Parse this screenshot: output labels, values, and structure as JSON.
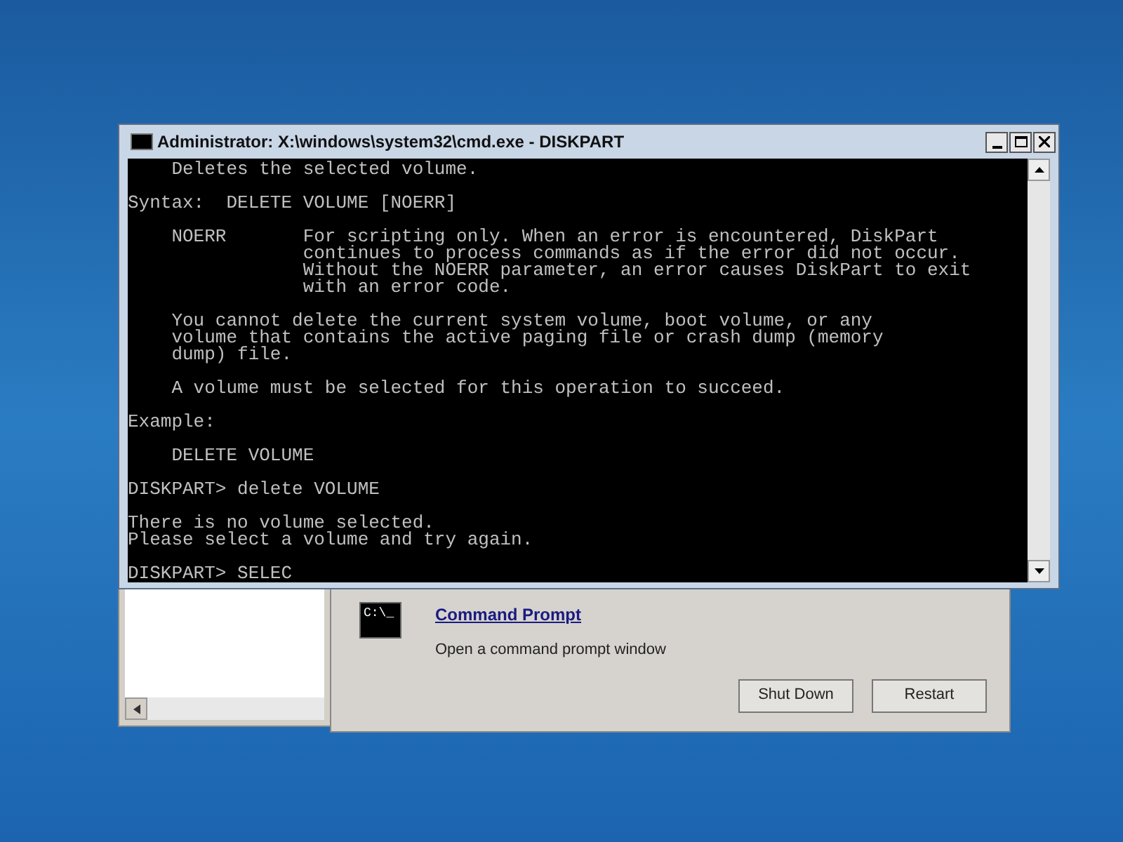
{
  "console_window": {
    "title": "Administrator: X:\\windows\\system32\\cmd.exe - DISKPART",
    "paragraphs": [
      [
        "    Deletes the selected volume."
      ],
      [
        "Syntax:  DELETE VOLUME [NOERR]"
      ],
      [
        "    NOERR       For scripting only. When an error is encountered, DiskPart",
        "                continues to process commands as if the error did not occur.",
        "                Without the NOERR parameter, an error causes DiskPart to exit",
        "                with an error code."
      ],
      [
        "    You cannot delete the current system volume, boot volume, or any",
        "    volume that contains the active paging file or crash dump (memory",
        "    dump) file."
      ],
      [
        "    A volume must be selected for this operation to succeed."
      ],
      [
        "Example:"
      ],
      [
        "    DELETE VOLUME"
      ],
      [
        "DISKPART> delete VOLUME"
      ],
      [
        "There is no volume selected.",
        "Please select a volume and try again."
      ],
      [
        "DISKPART> SELEC"
      ]
    ]
  },
  "recovery_panel": {
    "tool": {
      "icon_text": "C:\\_",
      "link": "Command Prompt",
      "description": "Open a command prompt window"
    },
    "buttons": [
      "Shut Down",
      "Restart"
    ]
  }
}
